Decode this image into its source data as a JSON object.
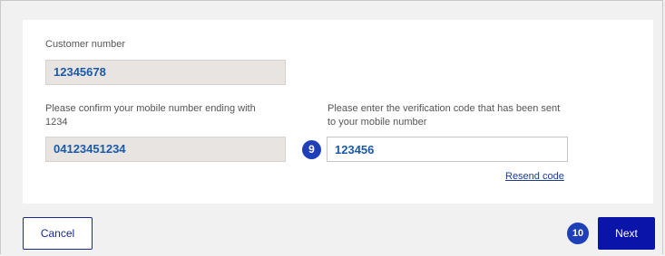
{
  "customer": {
    "label": "Customer number",
    "value": "12345678"
  },
  "mobile": {
    "label_line1": "Please confirm your mobile number ending with",
    "label_line2": "1234",
    "value": "04123451234"
  },
  "verification": {
    "label_line1": "Please enter the verification code that has been sent",
    "label_line2": "to your mobile number",
    "value": "123456",
    "step_number": "9",
    "resend_label": "Resend code"
  },
  "footer": {
    "cancel_label": "Cancel",
    "next_label": "Next",
    "next_step_number": "10"
  },
  "colors": {
    "accent": "#0a14a8",
    "badge": "#1e3fb8",
    "value_text": "#1a5aa8",
    "readonly_bg": "#e7e4e2"
  }
}
